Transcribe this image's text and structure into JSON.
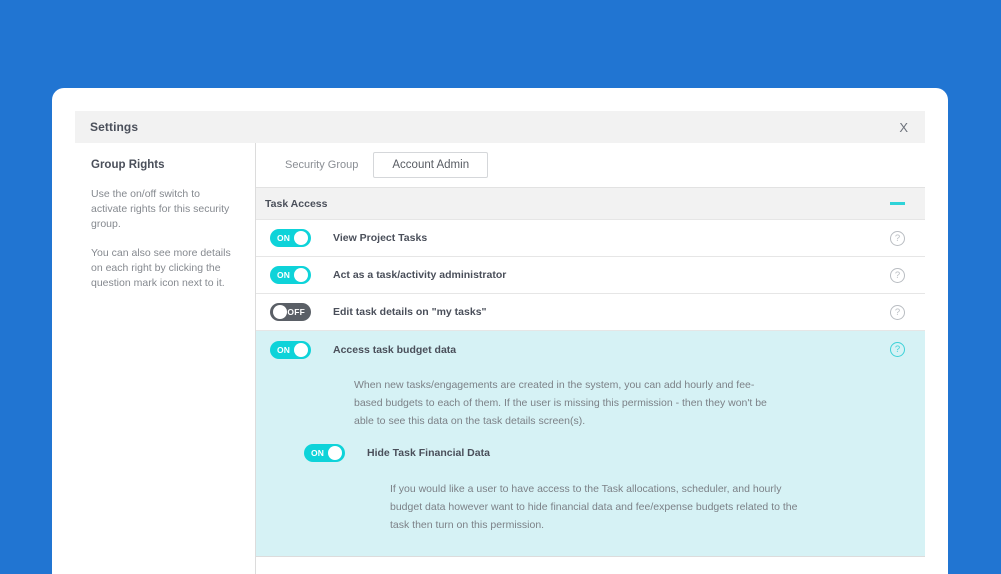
{
  "window": {
    "title": "Settings",
    "close_label": "X"
  },
  "sidebar": {
    "heading": "Group Rights",
    "paragraphs": [
      "Use the on/off switch to activate rights for this security group.",
      "You can also see more details on each right by clicking the question mark icon next to it."
    ]
  },
  "security_group": {
    "label": "Security Group",
    "value": "Account Admin"
  },
  "section": {
    "title": "Task Access",
    "collapse_icon": "minus-icon"
  },
  "rights": [
    {
      "label": "View Project Tasks",
      "toggle": "ON",
      "state": "on",
      "help": "?"
    },
    {
      "label": "Act as a task/activity administrator",
      "toggle": "ON",
      "state": "on",
      "help": "?"
    },
    {
      "label": "Edit task details on \"my tasks\"",
      "toggle": "OFF",
      "state": "off",
      "help": "?"
    },
    {
      "label": "Access task budget data",
      "toggle": "ON",
      "state": "on",
      "help": "?"
    }
  ],
  "expanded": {
    "description": "When new tasks/engagements are created in the system, you can add hourly and fee-based budgets to each of them. If the user is missing this permission - then they won't be able to see this data on the task details screen(s).",
    "sub_right": {
      "label": "Hide Task Financial Data",
      "toggle": "ON",
      "state": "on"
    },
    "sub_description": "If you would like a user to have access to the Task allocations, scheduler, and hourly budget data however want to hide financial data and fee/expense budgets related to the task then turn on this permission."
  },
  "colors": {
    "page_background": "#2175d2",
    "toggle_on": "#0ed3d9",
    "toggle_off": "#5a5f66",
    "accent_teal": "#3ed2d8",
    "highlight_row": "#d6f2f5"
  }
}
